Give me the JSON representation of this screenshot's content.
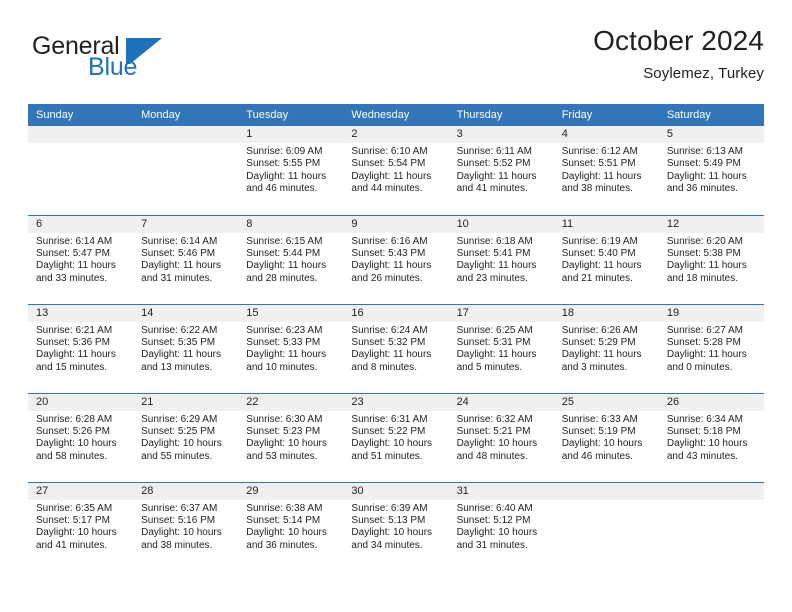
{
  "brand": {
    "name_part1": "General",
    "name_part2": "Blue",
    "flag_icon": "blue-flag-icon",
    "color_blue": "#1c72bd"
  },
  "header": {
    "title": "October 2024",
    "subtitle": "Soylemez, Turkey"
  },
  "theme": {
    "header_blue": "#3275b8",
    "band_gray": "#f0f0f0",
    "text": "#231f20"
  },
  "weekdays": [
    "Sunday",
    "Monday",
    "Tuesday",
    "Wednesday",
    "Thursday",
    "Friday",
    "Saturday"
  ],
  "weeks": [
    [
      {
        "day": "",
        "sunrise": "",
        "sunset": "",
        "daylight_line1": "",
        "daylight_line2": ""
      },
      {
        "day": "",
        "sunrise": "",
        "sunset": "",
        "daylight_line1": "",
        "daylight_line2": ""
      },
      {
        "day": "1",
        "sunrise": "Sunrise: 6:09 AM",
        "sunset": "Sunset: 5:55 PM",
        "daylight_line1": "Daylight: 11 hours",
        "daylight_line2": "and 46 minutes."
      },
      {
        "day": "2",
        "sunrise": "Sunrise: 6:10 AM",
        "sunset": "Sunset: 5:54 PM",
        "daylight_line1": "Daylight: 11 hours",
        "daylight_line2": "and 44 minutes."
      },
      {
        "day": "3",
        "sunrise": "Sunrise: 6:11 AM",
        "sunset": "Sunset: 5:52 PM",
        "daylight_line1": "Daylight: 11 hours",
        "daylight_line2": "and 41 minutes."
      },
      {
        "day": "4",
        "sunrise": "Sunrise: 6:12 AM",
        "sunset": "Sunset: 5:51 PM",
        "daylight_line1": "Daylight: 11 hours",
        "daylight_line2": "and 38 minutes."
      },
      {
        "day": "5",
        "sunrise": "Sunrise: 6:13 AM",
        "sunset": "Sunset: 5:49 PM",
        "daylight_line1": "Daylight: 11 hours",
        "daylight_line2": "and 36 minutes."
      }
    ],
    [
      {
        "day": "6",
        "sunrise": "Sunrise: 6:14 AM",
        "sunset": "Sunset: 5:47 PM",
        "daylight_line1": "Daylight: 11 hours",
        "daylight_line2": "and 33 minutes."
      },
      {
        "day": "7",
        "sunrise": "Sunrise: 6:14 AM",
        "sunset": "Sunset: 5:46 PM",
        "daylight_line1": "Daylight: 11 hours",
        "daylight_line2": "and 31 minutes."
      },
      {
        "day": "8",
        "sunrise": "Sunrise: 6:15 AM",
        "sunset": "Sunset: 5:44 PM",
        "daylight_line1": "Daylight: 11 hours",
        "daylight_line2": "and 28 minutes."
      },
      {
        "day": "9",
        "sunrise": "Sunrise: 6:16 AM",
        "sunset": "Sunset: 5:43 PM",
        "daylight_line1": "Daylight: 11 hours",
        "daylight_line2": "and 26 minutes."
      },
      {
        "day": "10",
        "sunrise": "Sunrise: 6:18 AM",
        "sunset": "Sunset: 5:41 PM",
        "daylight_line1": "Daylight: 11 hours",
        "daylight_line2": "and 23 minutes."
      },
      {
        "day": "11",
        "sunrise": "Sunrise: 6:19 AM",
        "sunset": "Sunset: 5:40 PM",
        "daylight_line1": "Daylight: 11 hours",
        "daylight_line2": "and 21 minutes."
      },
      {
        "day": "12",
        "sunrise": "Sunrise: 6:20 AM",
        "sunset": "Sunset: 5:38 PM",
        "daylight_line1": "Daylight: 11 hours",
        "daylight_line2": "and 18 minutes."
      }
    ],
    [
      {
        "day": "13",
        "sunrise": "Sunrise: 6:21 AM",
        "sunset": "Sunset: 5:36 PM",
        "daylight_line1": "Daylight: 11 hours",
        "daylight_line2": "and 15 minutes."
      },
      {
        "day": "14",
        "sunrise": "Sunrise: 6:22 AM",
        "sunset": "Sunset: 5:35 PM",
        "daylight_line1": "Daylight: 11 hours",
        "daylight_line2": "and 13 minutes."
      },
      {
        "day": "15",
        "sunrise": "Sunrise: 6:23 AM",
        "sunset": "Sunset: 5:33 PM",
        "daylight_line1": "Daylight: 11 hours",
        "daylight_line2": "and 10 minutes."
      },
      {
        "day": "16",
        "sunrise": "Sunrise: 6:24 AM",
        "sunset": "Sunset: 5:32 PM",
        "daylight_line1": "Daylight: 11 hours",
        "daylight_line2": "and 8 minutes."
      },
      {
        "day": "17",
        "sunrise": "Sunrise: 6:25 AM",
        "sunset": "Sunset: 5:31 PM",
        "daylight_line1": "Daylight: 11 hours",
        "daylight_line2": "and 5 minutes."
      },
      {
        "day": "18",
        "sunrise": "Sunrise: 6:26 AM",
        "sunset": "Sunset: 5:29 PM",
        "daylight_line1": "Daylight: 11 hours",
        "daylight_line2": "and 3 minutes."
      },
      {
        "day": "19",
        "sunrise": "Sunrise: 6:27 AM",
        "sunset": "Sunset: 5:28 PM",
        "daylight_line1": "Daylight: 11 hours",
        "daylight_line2": "and 0 minutes."
      }
    ],
    [
      {
        "day": "20",
        "sunrise": "Sunrise: 6:28 AM",
        "sunset": "Sunset: 5:26 PM",
        "daylight_line1": "Daylight: 10 hours",
        "daylight_line2": "and 58 minutes."
      },
      {
        "day": "21",
        "sunrise": "Sunrise: 6:29 AM",
        "sunset": "Sunset: 5:25 PM",
        "daylight_line1": "Daylight: 10 hours",
        "daylight_line2": "and 55 minutes."
      },
      {
        "day": "22",
        "sunrise": "Sunrise: 6:30 AM",
        "sunset": "Sunset: 5:23 PM",
        "daylight_line1": "Daylight: 10 hours",
        "daylight_line2": "and 53 minutes."
      },
      {
        "day": "23",
        "sunrise": "Sunrise: 6:31 AM",
        "sunset": "Sunset: 5:22 PM",
        "daylight_line1": "Daylight: 10 hours",
        "daylight_line2": "and 51 minutes."
      },
      {
        "day": "24",
        "sunrise": "Sunrise: 6:32 AM",
        "sunset": "Sunset: 5:21 PM",
        "daylight_line1": "Daylight: 10 hours",
        "daylight_line2": "and 48 minutes."
      },
      {
        "day": "25",
        "sunrise": "Sunrise: 6:33 AM",
        "sunset": "Sunset: 5:19 PM",
        "daylight_line1": "Daylight: 10 hours",
        "daylight_line2": "and 46 minutes."
      },
      {
        "day": "26",
        "sunrise": "Sunrise: 6:34 AM",
        "sunset": "Sunset: 5:18 PM",
        "daylight_line1": "Daylight: 10 hours",
        "daylight_line2": "and 43 minutes."
      }
    ],
    [
      {
        "day": "27",
        "sunrise": "Sunrise: 6:35 AM",
        "sunset": "Sunset: 5:17 PM",
        "daylight_line1": "Daylight: 10 hours",
        "daylight_line2": "and 41 minutes."
      },
      {
        "day": "28",
        "sunrise": "Sunrise: 6:37 AM",
        "sunset": "Sunset: 5:16 PM",
        "daylight_line1": "Daylight: 10 hours",
        "daylight_line2": "and 38 minutes."
      },
      {
        "day": "29",
        "sunrise": "Sunrise: 6:38 AM",
        "sunset": "Sunset: 5:14 PM",
        "daylight_line1": "Daylight: 10 hours",
        "daylight_line2": "and 36 minutes."
      },
      {
        "day": "30",
        "sunrise": "Sunrise: 6:39 AM",
        "sunset": "Sunset: 5:13 PM",
        "daylight_line1": "Daylight: 10 hours",
        "daylight_line2": "and 34 minutes."
      },
      {
        "day": "31",
        "sunrise": "Sunrise: 6:40 AM",
        "sunset": "Sunset: 5:12 PM",
        "daylight_line1": "Daylight: 10 hours",
        "daylight_line2": "and 31 minutes."
      },
      {
        "day": "",
        "sunrise": "",
        "sunset": "",
        "daylight_line1": "",
        "daylight_line2": ""
      },
      {
        "day": "",
        "sunrise": "",
        "sunset": "",
        "daylight_line1": "",
        "daylight_line2": ""
      }
    ]
  ]
}
